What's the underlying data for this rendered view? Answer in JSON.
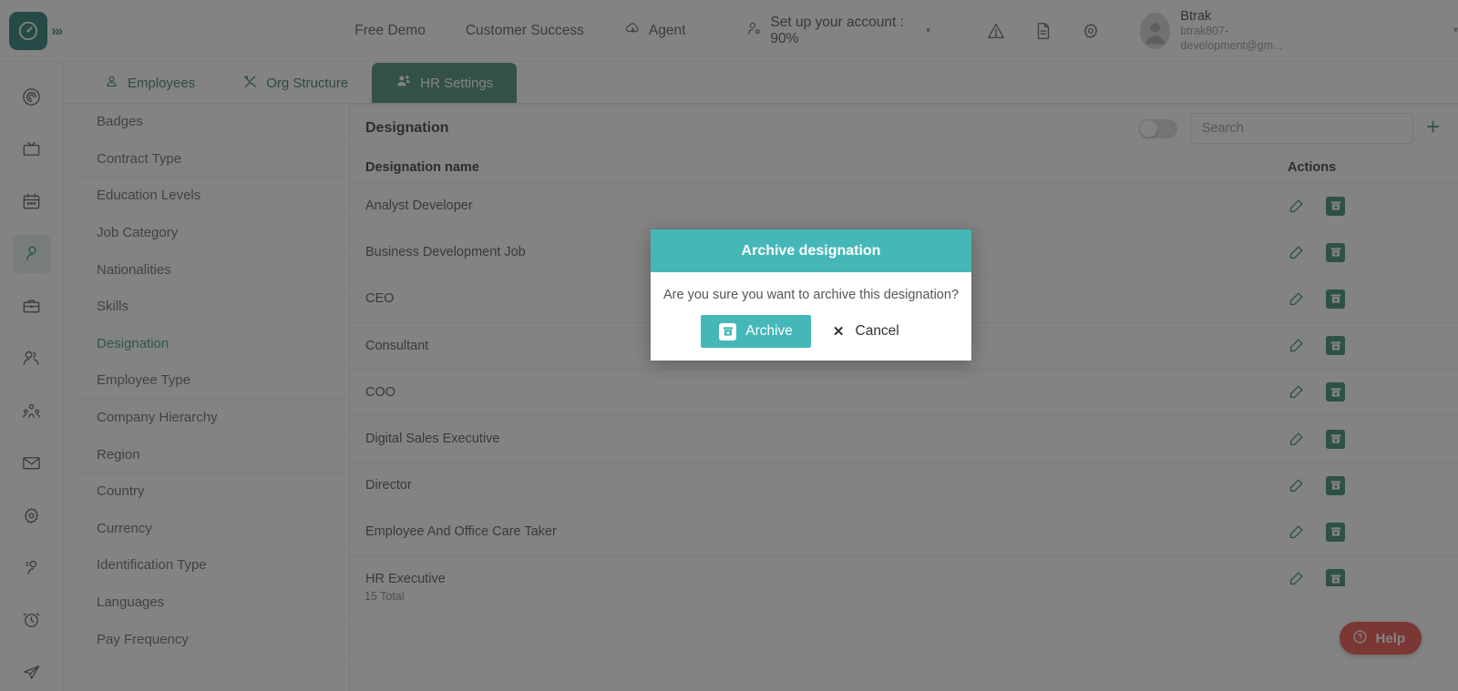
{
  "header": {
    "logo_icon": "btrak-speedometer-logo",
    "expand_icon": "chevron-double-right-icon",
    "nav": [
      {
        "label": "Free Demo",
        "icon": null
      },
      {
        "label": "Customer Success",
        "icon": null
      },
      {
        "label": "Agent",
        "icon": "cloud-download-icon"
      }
    ],
    "setup": {
      "label": "Set up your account : 90%",
      "icon": "account-setup-icon",
      "caret": "▾"
    },
    "icons": [
      "warning-triangle-icon",
      "document-icon",
      "gear-icon"
    ],
    "profile": {
      "name": "Btrak",
      "email": "btrak807-development@gm...",
      "avatar_icon": "avatar",
      "caret": "▾"
    }
  },
  "rail": {
    "items": [
      {
        "name": "dashboard-spiral-icon"
      },
      {
        "name": "tv-screen-icon"
      },
      {
        "name": "calendar-icon"
      },
      {
        "name": "person-icon",
        "active": true
      },
      {
        "name": "briefcase-icon"
      },
      {
        "name": "users-icon"
      },
      {
        "name": "team-hierarchy-icon"
      },
      {
        "name": "mail-icon"
      },
      {
        "name": "settings-gear-icon"
      },
      {
        "name": "user-badge-icon"
      },
      {
        "name": "alarm-clock-icon"
      },
      {
        "name": "send-paper-plane-icon"
      }
    ]
  },
  "tabs": [
    {
      "label": "Employees",
      "icon": "employee-icon",
      "active": false
    },
    {
      "label": "Org Structure",
      "icon": "tools-icon",
      "active": false
    },
    {
      "label": "HR Settings",
      "icon": "hr-people-icon",
      "active": true
    }
  ],
  "settings_menu": {
    "items": [
      {
        "label": "Badges",
        "active": false
      },
      {
        "label": "Contract Type",
        "active": false
      },
      {
        "label": "Education Levels",
        "active": false
      },
      {
        "label": "Job Category",
        "active": false
      },
      {
        "label": "Nationalities",
        "active": false
      },
      {
        "label": "Skills",
        "active": false
      },
      {
        "label": "Designation",
        "active": true
      },
      {
        "label": "Employee Type",
        "active": false
      },
      {
        "label": "Company Hierarchy",
        "active": false
      },
      {
        "label": "Region",
        "active": false
      },
      {
        "label": "Country",
        "active": false
      },
      {
        "label": "Currency",
        "active": false
      },
      {
        "label": "Identification Type",
        "active": false
      },
      {
        "label": "Languages",
        "active": false
      },
      {
        "label": "Pay Frequency",
        "active": false
      }
    ]
  },
  "panel": {
    "title": "Designation",
    "toggle_state": "off",
    "toggle_icon": "archived-toggle",
    "search_placeholder": "Search",
    "search_value": "",
    "add_icon": "plus-icon",
    "columns": [
      "Designation name",
      "Actions"
    ],
    "rows": [
      {
        "name": "Analyst Developer"
      },
      {
        "name": "Business Development Job"
      },
      {
        "name": "CEO"
      },
      {
        "name": "Consultant"
      },
      {
        "name": "COO"
      },
      {
        "name": "Digital Sales Executive"
      },
      {
        "name": "Director"
      },
      {
        "name": "Employee And Office Care Taker"
      },
      {
        "name": "HR Executive"
      }
    ],
    "row_actions": {
      "edit_icon": "edit-pencil-icon",
      "archive_icon": "archive-box-icon"
    },
    "total_label": "15 Total"
  },
  "modal": {
    "title": "Archive designation",
    "message": "Are you sure you want to archive this designation?",
    "confirm_label": "Archive",
    "confirm_icon": "archive-box-icon",
    "cancel_label": "Cancel",
    "cancel_icon": "close-x-icon"
  },
  "help": {
    "label": "Help",
    "icon": "question-circle-icon"
  },
  "colors": {
    "brand_green": "#1f7a62",
    "logo_green": "#0b6b5d",
    "modal_teal": "#45b7b8",
    "help_red": "#e8372d",
    "active_tab": "#2f7d68"
  }
}
